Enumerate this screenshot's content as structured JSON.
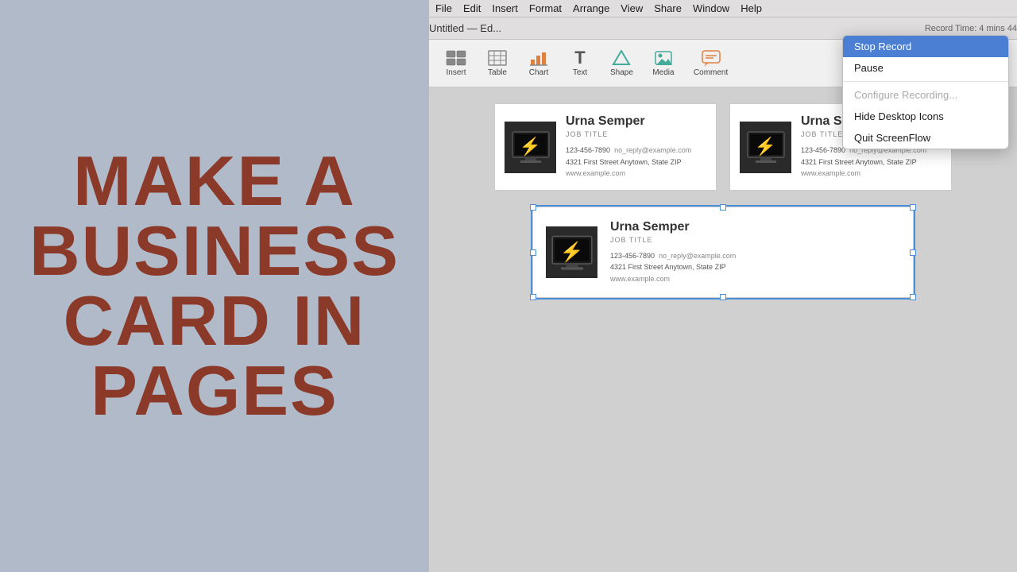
{
  "tutorial": {
    "title": "MAKE A BUSINESS CARD IN PAGES"
  },
  "menubar": {
    "items": [
      "File",
      "Edit",
      "Insert",
      "Format",
      "Arrange",
      "View",
      "Share",
      "Window",
      "Help"
    ]
  },
  "titlebar": {
    "text": "Untitled — Ed...",
    "record_time": "Record Time: 4 mins 44"
  },
  "toolbar": {
    "buttons": [
      {
        "id": "insert",
        "label": "Insert",
        "icon": "⊞"
      },
      {
        "id": "table",
        "label": "Table",
        "icon": "⊟"
      },
      {
        "id": "chart",
        "label": "Chart",
        "icon": "📊"
      },
      {
        "id": "text",
        "label": "Text",
        "icon": "T"
      },
      {
        "id": "shape",
        "label": "Shape",
        "icon": "⬡"
      },
      {
        "id": "media",
        "label": "Media",
        "icon": "🖼"
      },
      {
        "id": "comment",
        "label": "Comment",
        "icon": "💬"
      }
    ]
  },
  "cards": [
    {
      "name": "Urna Semper",
      "job_title": "JOB TITLE",
      "phone": "123-456-7890",
      "email": "no_reply@example.com",
      "address": "4321 First Street  Anytown, State  ZIP",
      "website": "www.example.com"
    },
    {
      "name": "Urna Se...",
      "job_title": "JOB TITLE",
      "phone": "123-456-7890",
      "email": "no_reply@example.com",
      "address": "4321 First Street  Anytown, State  ZIP",
      "website": "www.example.com"
    },
    {
      "name": "Urna Semper",
      "job_title": "JOB TITLE",
      "phone": "123-456-7890",
      "email": "no_reply@example.com",
      "address": "4321 First Street  Anytown, State  ZIP",
      "website": "www.example.com"
    }
  ],
  "dropdown": {
    "items": [
      {
        "id": "stop-record",
        "label": "Stop Record",
        "active": true
      },
      {
        "id": "pause",
        "label": "Pause",
        "active": false
      },
      {
        "id": "separator1",
        "type": "separator"
      },
      {
        "id": "configure",
        "label": "Configure Recording...",
        "disabled": true
      },
      {
        "id": "hide-icons",
        "label": "Hide Desktop Icons",
        "active": false
      },
      {
        "id": "quit",
        "label": "Quit ScreenFlow",
        "active": false
      }
    ]
  }
}
